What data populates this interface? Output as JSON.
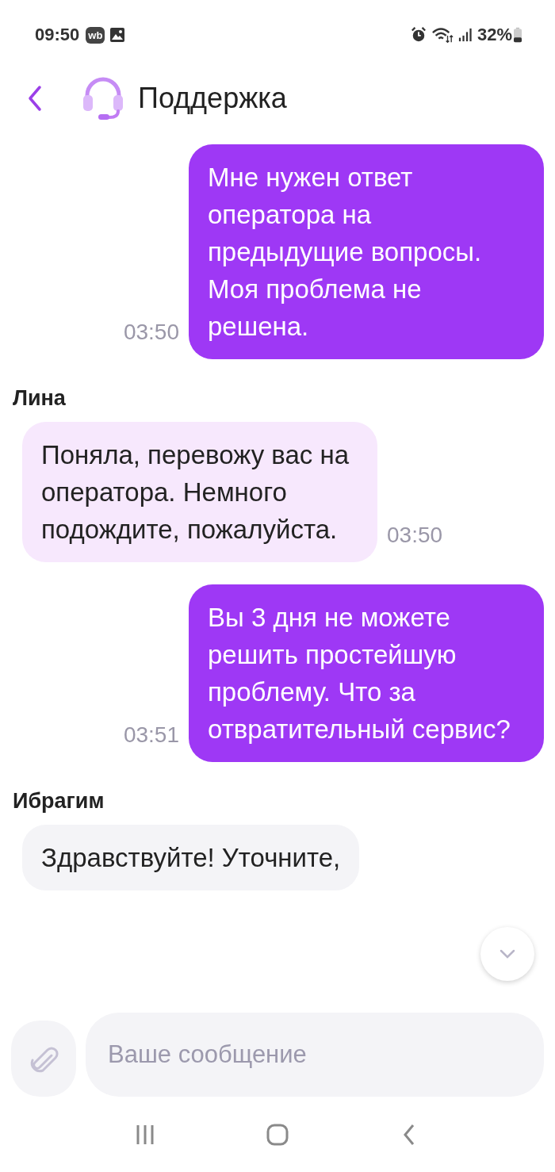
{
  "status_bar": {
    "time": "09:50",
    "app_badge": "wb",
    "battery": "32%"
  },
  "header": {
    "title": "Поддержка"
  },
  "messages": [
    {
      "kind": "outgoing",
      "text": "Мне нужен ответ оператора на предыдущие вопросы. Моя проблема не решена.",
      "time": "03:50"
    },
    {
      "kind": "incoming",
      "sender": "Лина",
      "text": "Поняла, перевожу вас на оператора. Немного подождите, пожалуйста.",
      "time": "03:50"
    },
    {
      "kind": "outgoing",
      "text": "Вы 3 дня не можете решить простейшую проблему. Что за отвратительный сервис?",
      "time": "03:51"
    },
    {
      "kind": "incoming",
      "sender": "Ибрагим",
      "text": "Здравствуйте! Уточните,"
    }
  ],
  "composer": {
    "placeholder": "Ваше сообщение"
  }
}
